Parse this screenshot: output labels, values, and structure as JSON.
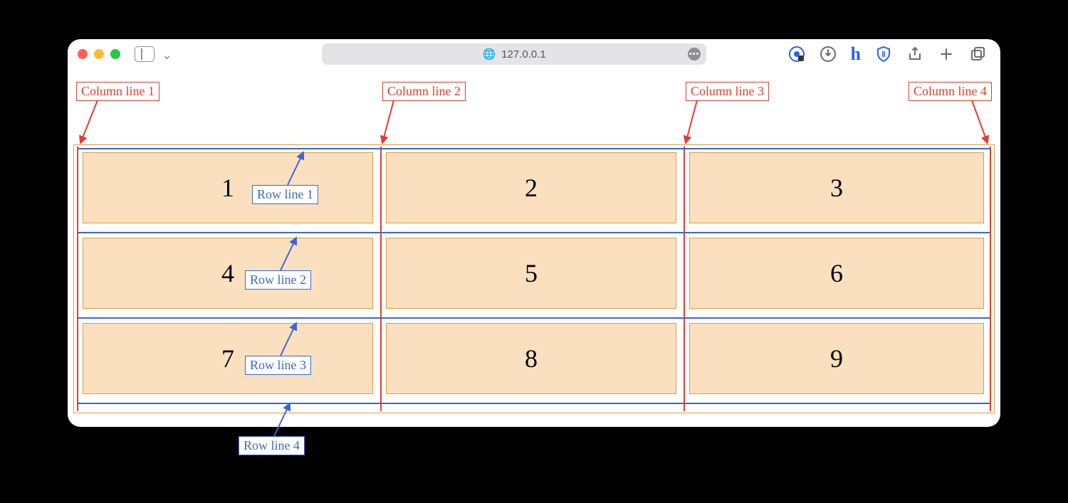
{
  "chrome": {
    "address": "127.0.0.1"
  },
  "diagram": {
    "column_labels": [
      "Column line 1",
      "Column line 2",
      "Column line 3",
      "Column line 4"
    ],
    "row_labels": [
      "Row line 1",
      "Row line 2",
      "Row line 3",
      "Row line 4"
    ],
    "cells": [
      "1",
      "2",
      "3",
      "4",
      "5",
      "6",
      "7",
      "8",
      "9"
    ]
  },
  "colors": {
    "column_line": "#e63b2e",
    "row_line": "#3b66d6",
    "cell_fill": "#fbe0c0",
    "cell_border": "#e69a3a"
  }
}
